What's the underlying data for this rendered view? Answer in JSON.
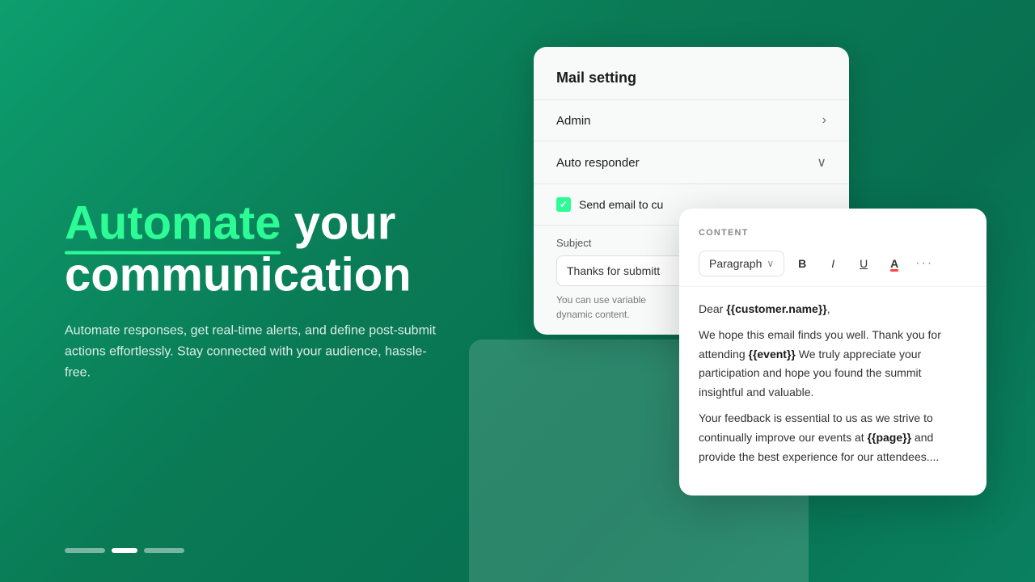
{
  "background": {
    "color_start": "#0d9e6e",
    "color_end": "#087050"
  },
  "left": {
    "headline_highlight": "Automate",
    "headline_rest": " your\ncommunication",
    "subtext": "Automate responses, get real-time alerts, and define post-submit actions effortlessly. Stay connected with your audience, hassle-free."
  },
  "pagination": {
    "dots": [
      {
        "type": "inactive"
      },
      {
        "type": "active"
      },
      {
        "type": "inactive"
      }
    ]
  },
  "mail_card": {
    "title": "Mail setting",
    "admin_label": "Admin",
    "admin_chevron": "›",
    "autoresponder_label": "Auto responder",
    "autoresponder_chevron": "∨",
    "send_label": "Send email to cu",
    "subject_label": "Subject",
    "subject_value": "Thanks for submitt",
    "variables_hint": "You can use variable\ndynamic content."
  },
  "content_card": {
    "section_label": "CONTENT",
    "paragraph_label": "Paragraph",
    "toolbar": {
      "bold": "B",
      "italic": "I",
      "underline": "U",
      "color": "A",
      "more": "···"
    },
    "email_lines": [
      {
        "type": "text_with_var",
        "before": "Dear ",
        "var": "{{customer.name}}",
        "after": ","
      },
      {
        "type": "text_with_var",
        "before": "We hope this email finds you well. Thank you for attending ",
        "var": "{{event}}",
        "after": " We truly appreciate your participation and hope you found the summit insightful and valuable."
      },
      {
        "type": "text_with_var",
        "before": "Your feedback is essential to us as we strive to continually improve our events at ",
        "var": "{{page}}",
        "after": " and provide the best experience for our attendees...."
      }
    ]
  }
}
